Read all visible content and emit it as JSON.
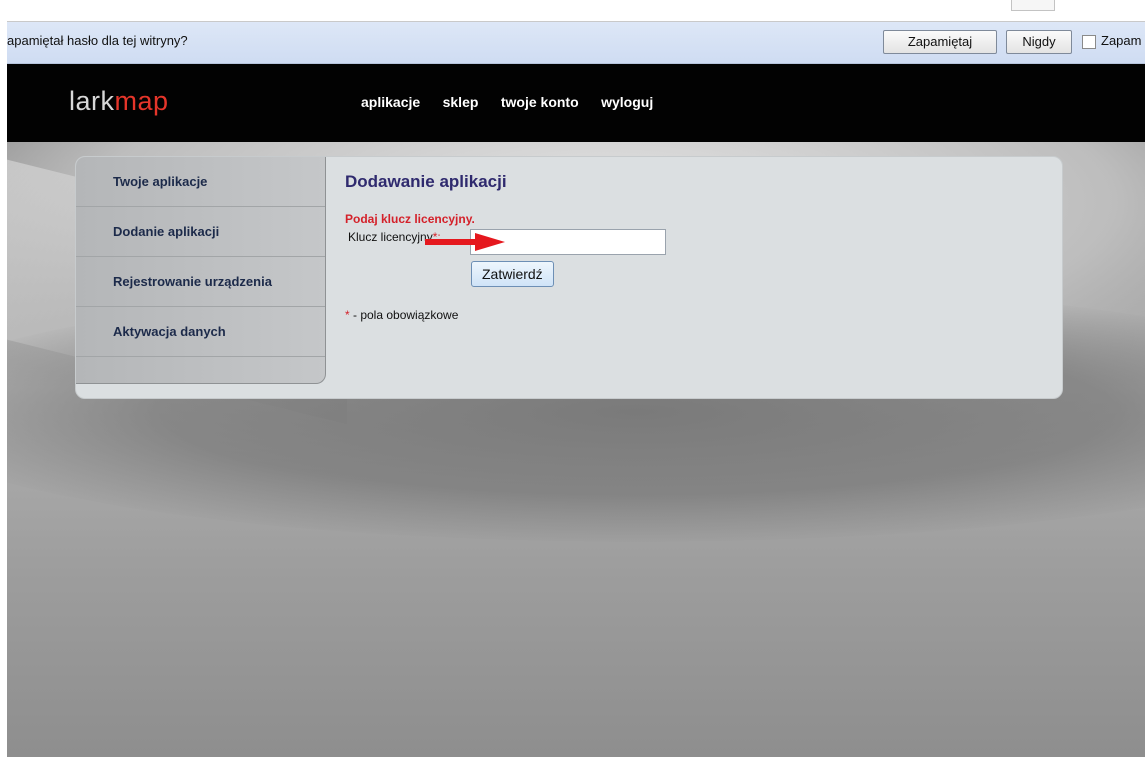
{
  "browser": {
    "password_prompt": {
      "message": "apamiętał hasło dla tej witryny?",
      "save_label": "Zapamiętaj",
      "never_label": "Nigdy",
      "checkbox_label": "Zapam"
    }
  },
  "site": {
    "logo": {
      "part1": "lark",
      "part2": "map"
    },
    "nav": [
      {
        "label": "aplikacje"
      },
      {
        "label": "sklep"
      },
      {
        "label": "twoje konto"
      },
      {
        "label": "wyloguj"
      }
    ]
  },
  "sidebar": {
    "items": [
      {
        "label": "Twoje aplikacje"
      },
      {
        "label": "Dodanie aplikacji"
      },
      {
        "label": "Rejestrowanie urządzenia"
      },
      {
        "label": "Aktywacja danych"
      }
    ]
  },
  "main": {
    "title": "Dodawanie aplikacji",
    "prompt": "Podaj klucz licencyjny.",
    "field_label": "Klucz licencyjny",
    "field_required_mark": "*:",
    "license_value": "",
    "submit_label": "Zatwierdź",
    "legend_mark": "*",
    "legend_text": " - pola obowiązkowe"
  },
  "colors": {
    "accent_red": "#d4212a",
    "title_purple": "#2f2a6e",
    "header_black": "#020202"
  }
}
